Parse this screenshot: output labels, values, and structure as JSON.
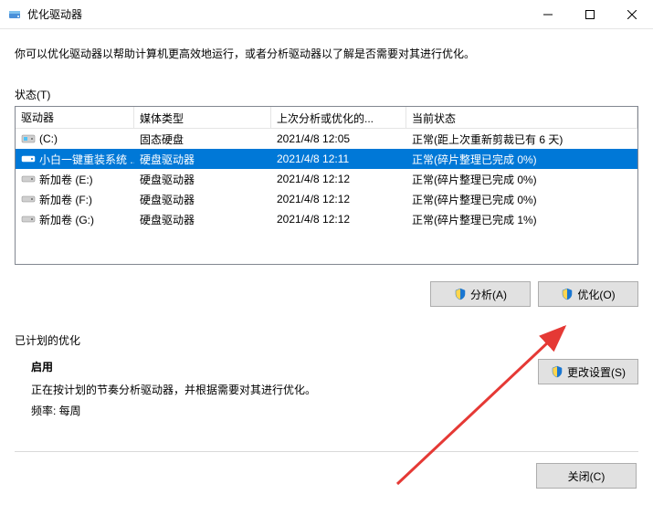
{
  "window": {
    "title": "优化驱动器",
    "desc": "你可以优化驱动器以帮助计算机更高效地运行，或者分析驱动器以了解是否需要对其进行优化。"
  },
  "status_label": "状态(T)",
  "columns": {
    "drive": "驱动器",
    "type": "媒体类型",
    "date": "上次分析或优化的...",
    "status": "当前状态"
  },
  "drives": [
    {
      "icon": "disk-c",
      "name": "(C:)",
      "type": "固态硬盘",
      "date": "2021/4/8 12:05",
      "status": "正常(距上次重新剪裁已有 6 天)",
      "selected": false
    },
    {
      "icon": "disk",
      "name": "小白一键重装系统 ...",
      "type": "硬盘驱动器",
      "date": "2021/4/8 12:11",
      "status": "正常(碎片整理已完成 0%)",
      "selected": true
    },
    {
      "icon": "disk",
      "name": "新加卷 (E:)",
      "type": "硬盘驱动器",
      "date": "2021/4/8 12:12",
      "status": "正常(碎片整理已完成 0%)",
      "selected": false
    },
    {
      "icon": "disk",
      "name": "新加卷 (F:)",
      "type": "硬盘驱动器",
      "date": "2021/4/8 12:12",
      "status": "正常(碎片整理已完成 0%)",
      "selected": false
    },
    {
      "icon": "disk",
      "name": "新加卷 (G:)",
      "type": "硬盘驱动器",
      "date": "2021/4/8 12:12",
      "status": "正常(碎片整理已完成 1%)",
      "selected": false
    }
  ],
  "buttons": {
    "analyze": "分析(A)",
    "optimize": "优化(O)",
    "change_settings": "更改设置(S)",
    "close": "关闭(C)"
  },
  "scheduled": {
    "label": "已计划的优化",
    "enabled": "启用",
    "desc": "正在按计划的节奏分析驱动器，并根据需要对其进行优化。",
    "freq": "频率: 每周"
  }
}
